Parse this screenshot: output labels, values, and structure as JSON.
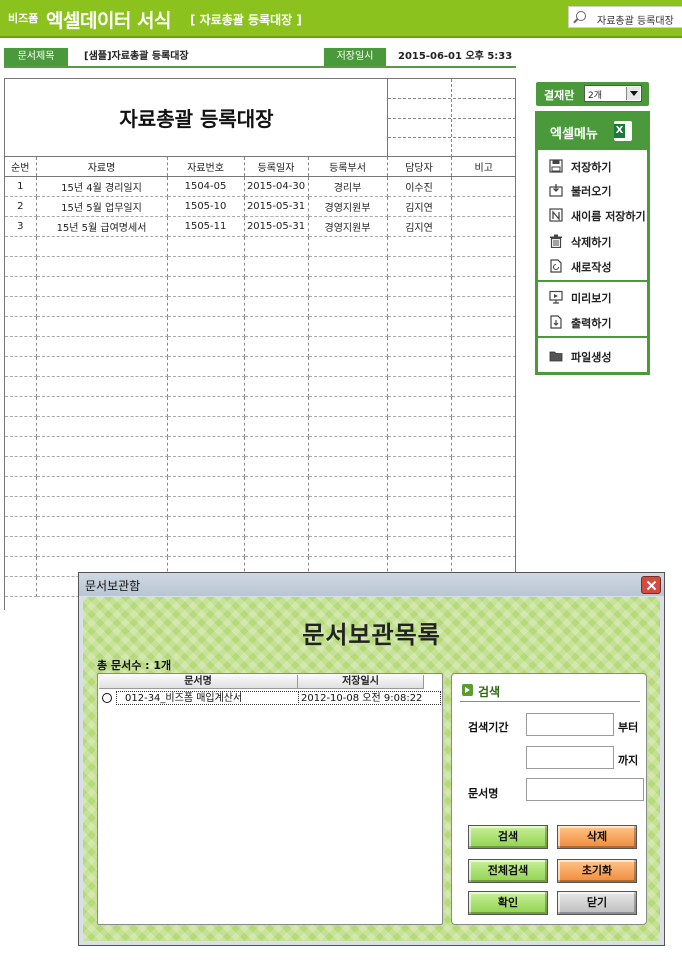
{
  "header": {
    "brand_small": "비즈폼",
    "brand_main": "엑셀데이터 서식",
    "subtitle": "[ 자료총괄 등록대장 ]",
    "search_text": "자료총괄 등록대장"
  },
  "info": {
    "title_label": "문서제목",
    "title_value": "[샘플]자료총괄 등록대장",
    "date_label": "저장일시",
    "date_value": "2015-06-01 오후 5:33"
  },
  "sheet": {
    "title": "자료총괄 등록대장",
    "columns": [
      "순번",
      "자료명",
      "자료번호",
      "등록일자",
      "등록부서",
      "담당자",
      "비고"
    ],
    "rows": [
      [
        "1",
        "15년 4월 경리일지",
        "1504-05",
        "2015-04-30",
        "경리부",
        "이수진",
        ""
      ],
      [
        "2",
        "15년 5월 업무일지",
        "1505-10",
        "2015-05-31",
        "경영지원부",
        "김지연",
        ""
      ],
      [
        "3",
        "15년 5월 급여명세서",
        "1505-11",
        "2015-05-31",
        "경영지원부",
        "김지연",
        ""
      ]
    ]
  },
  "right_panel": {
    "approval_label": "결재란",
    "approval_value": "2개",
    "menu_title": "엑셀메뉴",
    "menu_badge": "X",
    "menu_items": [
      "저장하기",
      "불러오기",
      "새이름 저장하기",
      "삭제하기",
      "새로작성",
      "미리보기",
      "출력하기",
      "파일생성"
    ]
  },
  "dialog": {
    "window_title": "문서보관함",
    "heading": "문서보관목록",
    "total_label": "총 문서수 : 1개",
    "list_headers": [
      "문서명",
      "저장일시"
    ],
    "list_rows": [
      {
        "name": "012-34_비즈폼 매입계산서",
        "saved": "2012-10-08 오전 9:08:22"
      }
    ],
    "search": {
      "title": "검색",
      "period_label": "검색기간",
      "from_label": "부터",
      "to_label": "까지",
      "name_label": "문서명"
    },
    "buttons": {
      "search": "검색",
      "delete": "삭제",
      "search_all": "전체검색",
      "reset": "초기화",
      "confirm": "확인",
      "close": "닫기"
    }
  },
  "colors": {
    "header_green": "#8cc21e",
    "accent_green": "#4a9a3c",
    "dialog_bg": "#b6d97a"
  }
}
